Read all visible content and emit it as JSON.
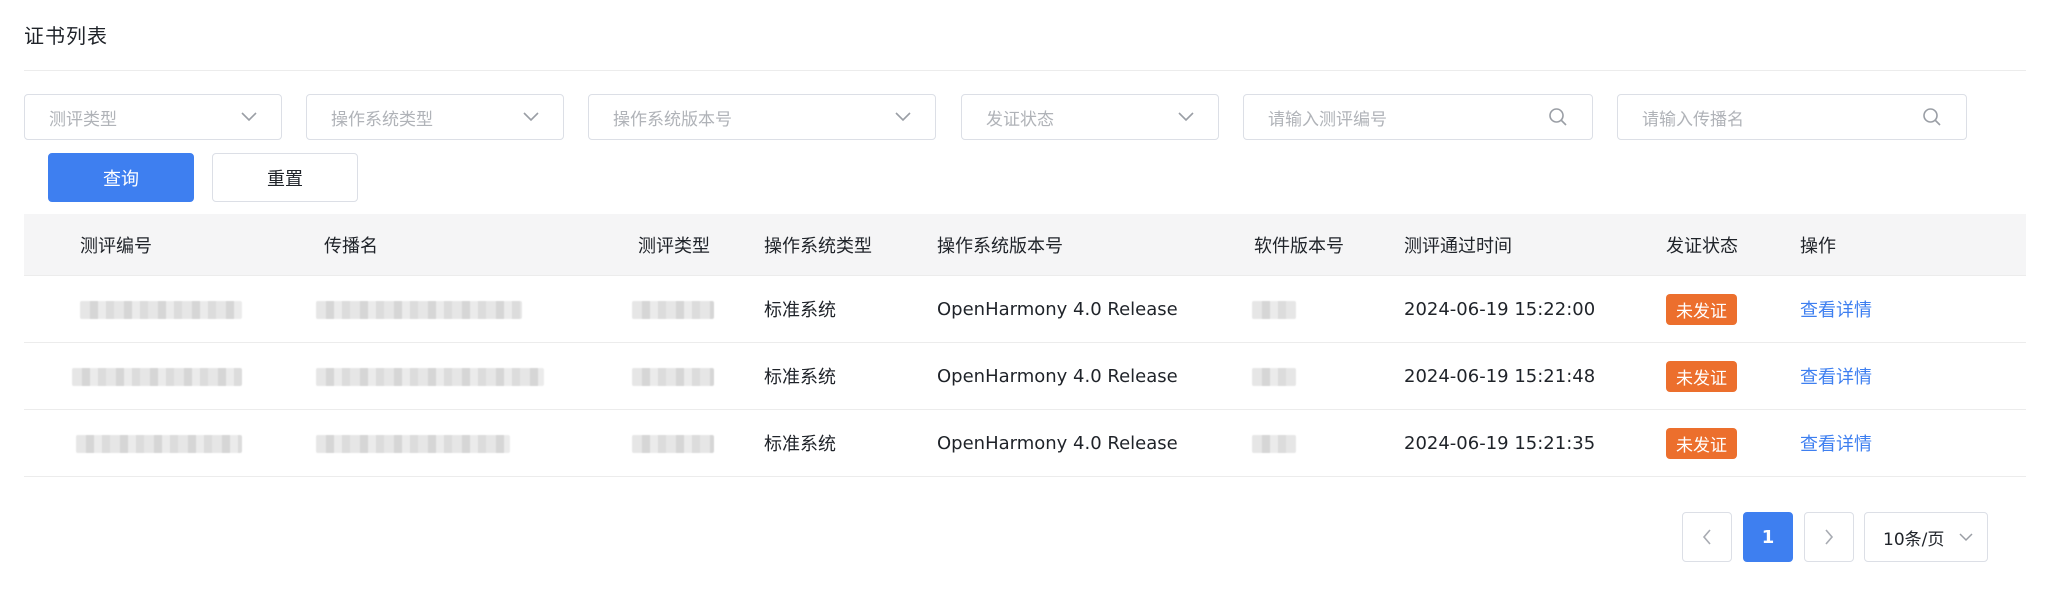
{
  "header": {
    "title": "证书列表"
  },
  "filters": {
    "eval_type": {
      "placeholder": "测评类型"
    },
    "os_type": {
      "placeholder": "操作系统类型"
    },
    "os_version": {
      "placeholder": "操作系统版本号"
    },
    "cert_status": {
      "placeholder": "发证状态"
    },
    "eval_no": {
      "placeholder": "请输入测评编号"
    },
    "dist_name": {
      "placeholder": "请输入传播名"
    }
  },
  "buttons": {
    "query": "查询",
    "reset": "重置"
  },
  "table": {
    "columns": [
      "测评编号",
      "传播名",
      "测评类型",
      "操作系统类型",
      "操作系统版本号",
      "软件版本号",
      "测评通过时间",
      "发证状态",
      "操作"
    ],
    "rows": [
      {
        "os_type": "标准系统",
        "os_version": "OpenHarmony 4.0 Release",
        "pass_time": "2024-06-19 15:22:00",
        "status": "未发证",
        "action": "查看详情"
      },
      {
        "os_type": "标准系统",
        "os_version": "OpenHarmony 4.0 Release",
        "pass_time": "2024-06-19 15:21:48",
        "status": "未发证",
        "action": "查看详情"
      },
      {
        "os_type": "标准系统",
        "os_version": "OpenHarmony 4.0 Release",
        "pass_time": "2024-06-19 15:21:35",
        "status": "未发证",
        "action": "查看详情"
      }
    ]
  },
  "pagination": {
    "current_page": "1",
    "page_size": "10条/页"
  },
  "colors": {
    "primary": "#3e7ff0",
    "badge": "#ec6f2d",
    "border": "#dcdfe6",
    "header_bg": "#f5f5f6"
  },
  "icons": [
    "chevron-down-icon",
    "search-icon",
    "chevron-left-icon",
    "chevron-right-icon"
  ]
}
